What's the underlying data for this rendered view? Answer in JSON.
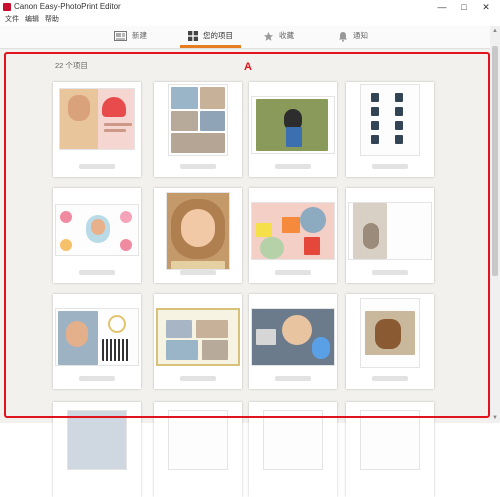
{
  "window": {
    "title": "Canon Easy-PhotoPrint Editor"
  },
  "menu": [
    "文件",
    "编辑",
    "帮助"
  ],
  "tabs": [
    {
      "label": "新建",
      "icon": "new-project-icon",
      "active": false
    },
    {
      "label": "您的项目",
      "icon": "grid-icon",
      "active": true
    },
    {
      "label": "收藏",
      "icon": "star-icon",
      "active": false
    },
    {
      "label": "通知",
      "icon": "bell-icon",
      "active": false
    }
  ],
  "main": {
    "item_count": "22 个项目",
    "region_marker": "A",
    "projects": [
      {
        "type": "photo-collage"
      },
      {
        "type": "photo-layout"
      },
      {
        "type": "single-photo"
      },
      {
        "type": "id-photo"
      },
      {
        "type": "card"
      },
      {
        "type": "photo-frame"
      },
      {
        "type": "collage"
      },
      {
        "type": "photo"
      },
      {
        "type": "calendar"
      },
      {
        "type": "photo-layout"
      },
      {
        "type": "collage"
      },
      {
        "type": "photo"
      }
    ]
  },
  "colors": {
    "accent": "#e67e22",
    "highlight": "#e0141e",
    "background": "#f3f1ed"
  }
}
